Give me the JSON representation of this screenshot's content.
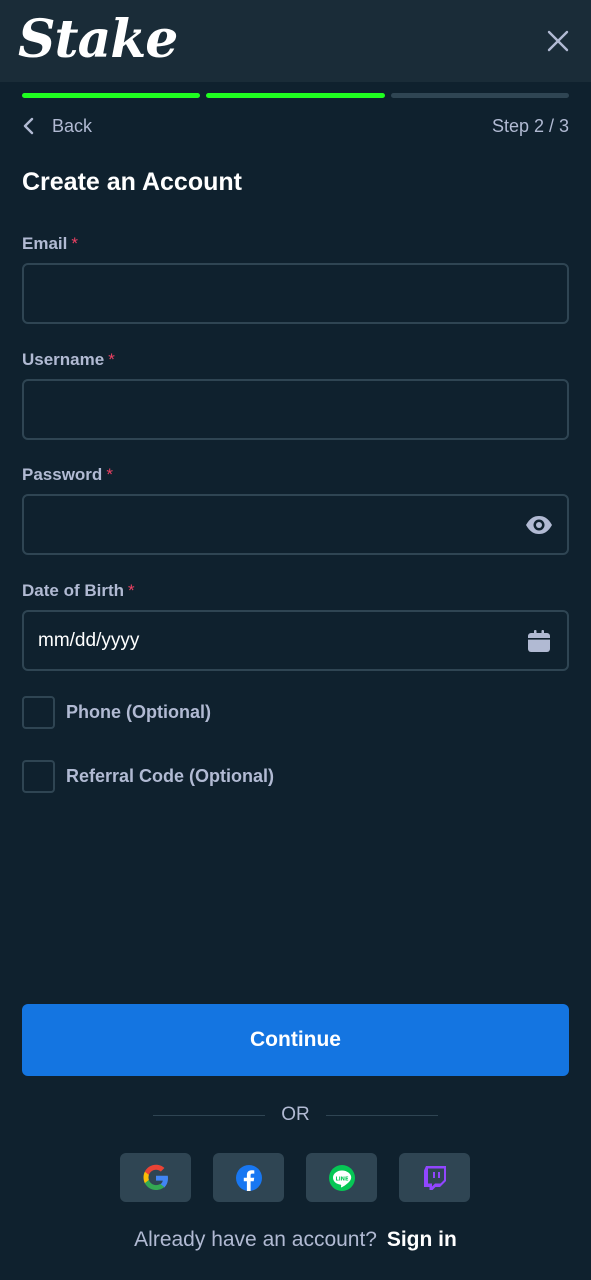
{
  "header": {
    "logo_text": "Stake",
    "close_icon": "close-icon"
  },
  "progress": {
    "current_step": 2,
    "total_steps": 3
  },
  "nav": {
    "back_label": "Back",
    "step_text": "Step 2 / 3"
  },
  "form": {
    "title": "Create an Account",
    "required_marker": "*",
    "email": {
      "label": "Email",
      "value": ""
    },
    "username": {
      "label": "Username",
      "value": ""
    },
    "password": {
      "label": "Password",
      "value": "",
      "icon": "eye-icon"
    },
    "dob": {
      "label": "Date of Birth",
      "placeholder": "mm/dd/yyyy",
      "icon": "calendar-icon"
    },
    "phone_option": {
      "label": "Phone (Optional)",
      "checked": false
    },
    "referral_option": {
      "label": "Referral Code (Optional)",
      "checked": false
    }
  },
  "actions": {
    "continue_label": "Continue",
    "or_label": "OR",
    "social": [
      "google-icon",
      "facebook-icon",
      "line-icon",
      "twitch-icon"
    ],
    "signin_prompt": "Already have an account?",
    "signin_link": "Sign in"
  },
  "colors": {
    "background": "#0f212e",
    "header": "#1a2c38",
    "progress_done": "#1fff20",
    "progress_pending": "#2f4553",
    "primary_button": "#1475e1",
    "required_marker": "#ed4163",
    "muted_text": "#b1bad3"
  }
}
